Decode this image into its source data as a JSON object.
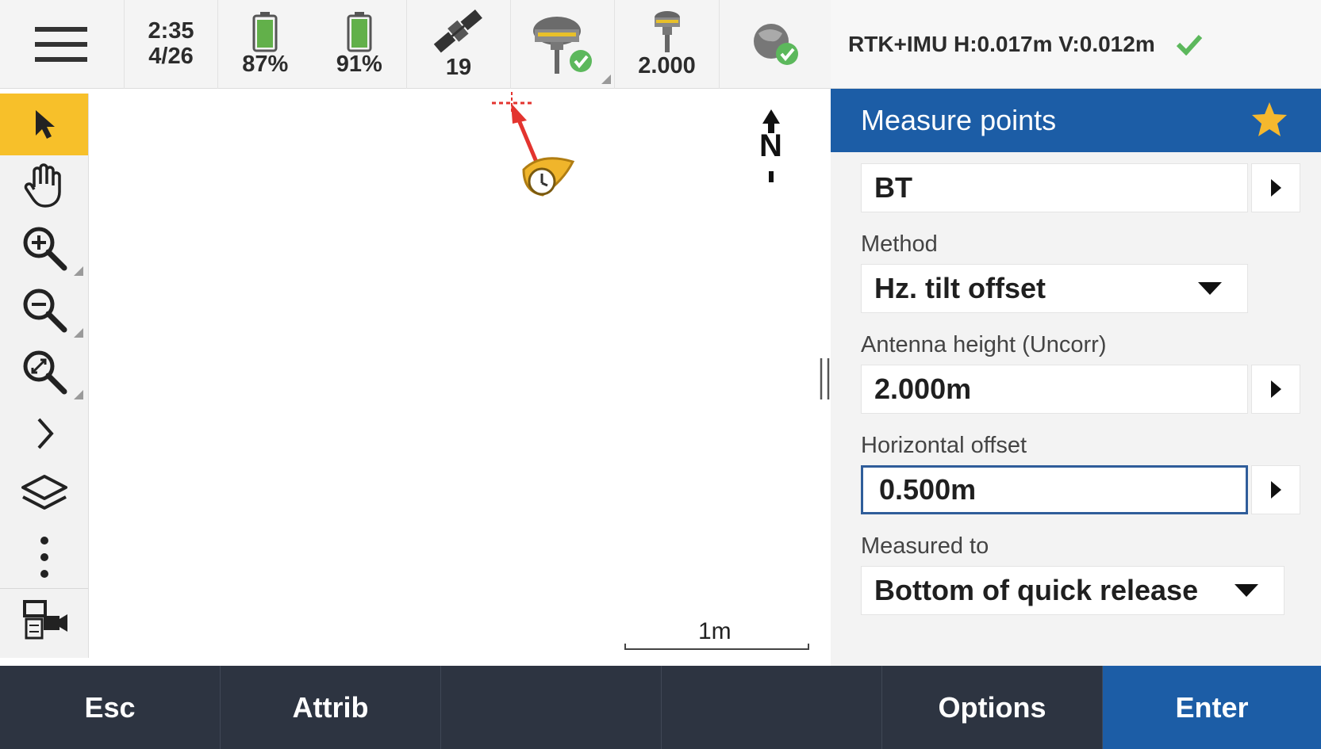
{
  "status": {
    "time": "2:35",
    "date": "4/26",
    "battery_1": "87%",
    "battery_2": "91%",
    "satellites": "19",
    "antenna_height": "2.000",
    "rtk_status": "RTK+IMU H:0.017m V:0.012m"
  },
  "map": {
    "north_label": "N",
    "scale_label": "1m"
  },
  "panel": {
    "title": "Measure points",
    "code_value": "BT",
    "method_label": "Method",
    "method_value": "Hz. tilt offset",
    "antenna_label": "Antenna height (Uncorr)",
    "antenna_value": "2.000m",
    "offset_label": "Horizontal offset",
    "offset_value": "0.500m",
    "measured_to_label": "Measured to",
    "measured_to_value": "Bottom of quick release"
  },
  "softkeys": {
    "esc": "Esc",
    "attrib": "Attrib",
    "options": "Options",
    "enter": "Enter"
  },
  "icons": {
    "menu": "hamburger-icon",
    "battery": "battery-icon",
    "satellite": "satellite-icon",
    "receiver": "gnss-receiver-icon",
    "antenna": "antenna-icon",
    "network": "network-status-icon",
    "status_ok": "check-icon",
    "favorite": "star-icon"
  },
  "colors": {
    "header_blue": "#1c5da6",
    "active_tool": "#f7c02a",
    "ok_green": "#5cb85c",
    "bottom_bar": "#2d3441"
  }
}
